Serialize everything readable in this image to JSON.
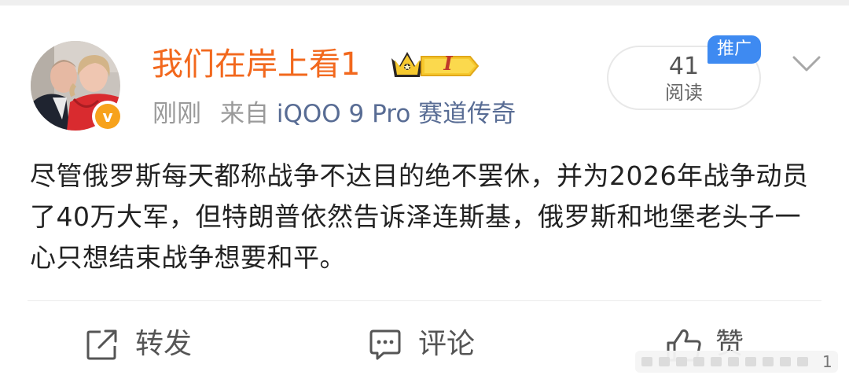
{
  "post": {
    "username": "我们在岸上看1",
    "rank_badge_letter": "I",
    "verified_mark": "v",
    "time": "刚刚",
    "source_prefix": "来自",
    "source_device": "iQOO 9 Pro 赛道传奇",
    "read_count": "41",
    "read_label": "阅读",
    "promo_tag": "推广",
    "content": "尽管俄罗斯每天都称战争不达目的绝不罢休，并为2026年战争动员了40万大军，但特朗普依然告诉泽连斯基，俄罗斯和地堡老头子一心只想结束战争想要和平。"
  },
  "actions": {
    "repost_label": "转发",
    "comment_label": "评论",
    "like_label": "赞"
  },
  "watermark": {
    "trailing_digit": "1"
  },
  "icons": {
    "avatar": "avatar-photo",
    "verified": "verified-badge-icon",
    "rank": "crown-rank-badge-icon",
    "chevron": "chevron-down-icon",
    "repost": "repost-icon",
    "comment": "comment-icon",
    "like": "like-icon"
  },
  "colors": {
    "username": "#f2681d",
    "source": "#586c94",
    "meta": "#9a9a9a",
    "promo": "#3e8af1",
    "verified": "#f7a21b",
    "badge_gold": "#f6c92e"
  }
}
